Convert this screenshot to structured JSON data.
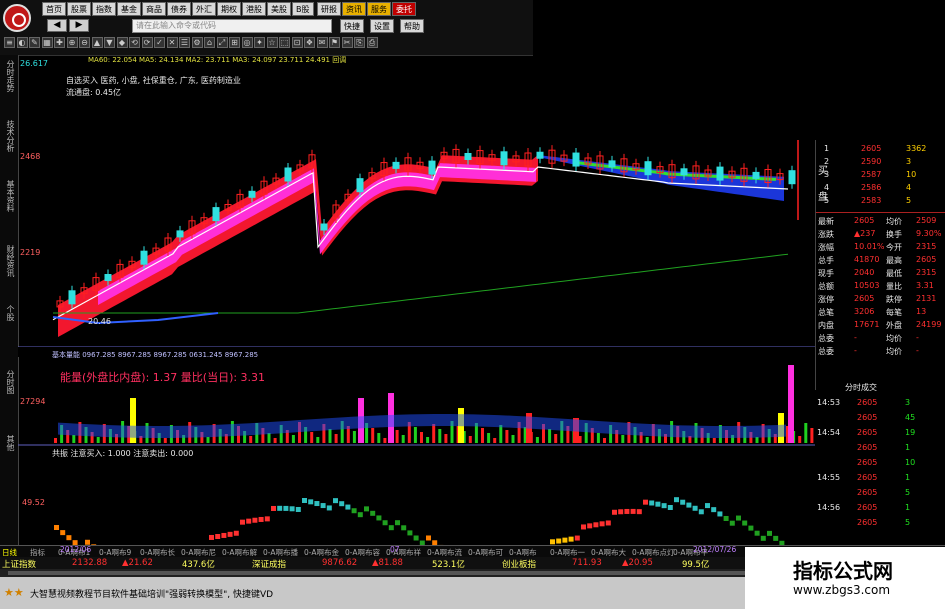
{
  "top_menu": [
    "首页",
    "股票",
    "指数",
    "基金",
    "商品",
    "债券",
    "外汇",
    "期权",
    "港股",
    "美股",
    "B股",
    "研报",
    "资讯",
    "服务",
    "委托"
  ],
  "top_menu_right": [
    "快捷",
    "设置",
    "帮助"
  ],
  "command_placeholder": "请在此输入命令或代码",
  "sidebar_tabs": [
    "分时走势",
    "技术分析",
    "基本资料",
    "财经资讯",
    "个股",
    "分时图",
    "其他"
  ],
  "chart": {
    "price_top": "26.617",
    "price_mid1": "2468",
    "price_mid2": "2219",
    "price_low": "20.46",
    "vol_top": "27294",
    "osc_mid": "49.52",
    "info_line": "MA60: 22.054  MA5: 24.134  MA2: 23.711  MA3: 24.097  23.711  24.491  回调",
    "note1": "自选买入 医药, 小盘, 社保重仓, 广东, 医药制造业",
    "note2": "流通盘: 0.45亿",
    "vol_label": "能量(外盘比内盘): 1.37   量比(当日): 3.31",
    "vol_indicator": "基本量能 0967.285  8967.285  8967.285  0631.245  8967.285",
    "osc_label": "共振   注意买入: 1.000   注意卖出: 0.000",
    "date_left": "2012/06",
    "date_mid": "07",
    "date_right": "2012/07/26"
  },
  "quote": {
    "bids": [
      {
        "label": "1",
        "price": "2605",
        "vol": "3362"
      },
      {
        "label": "2",
        "price": "2590",
        "vol": "3"
      },
      {
        "label": "3",
        "price": "2587",
        "vol": "10"
      },
      {
        "label": "4",
        "price": "2586",
        "vol": "4"
      },
      {
        "label": "5",
        "price": "2583",
        "vol": "5"
      }
    ],
    "side_labels": [
      "买",
      "盘"
    ],
    "fields": [
      [
        "最新",
        "2605",
        "均价",
        "2509"
      ],
      [
        "涨跌",
        "▲237",
        "换手",
        "9.30%"
      ],
      [
        "涨幅",
        "10.01%",
        "今开",
        "2315"
      ],
      [
        "总手",
        "41870",
        "最高",
        "2605"
      ],
      [
        "现手",
        "2040",
        "最低",
        "2315"
      ],
      [
        "总额",
        "10503",
        "量比",
        "3.31"
      ],
      [
        "涨停",
        "2605",
        "跌停",
        "2131"
      ],
      [
        "总笔",
        "3206",
        "每笔",
        "13"
      ],
      [
        "内盘",
        "17671",
        "外盘",
        "24199"
      ],
      [
        "总委",
        "-",
        "均价",
        "-"
      ],
      [
        "总委",
        "-",
        "均价",
        "-"
      ]
    ],
    "ticks_header": "分时成交",
    "ticks": [
      [
        "14:53",
        "2605",
        "3"
      ],
      [
        "",
        "2605",
        "45"
      ],
      [
        "14:54",
        "2605",
        "19"
      ],
      [
        "",
        "2605",
        "1"
      ],
      [
        "",
        "2605",
        "10"
      ],
      [
        "14:55",
        "2605",
        "1"
      ],
      [
        "",
        "2605",
        "5"
      ],
      [
        "14:56",
        "2605",
        "1"
      ],
      [
        "",
        "2605",
        "5"
      ]
    ]
  },
  "bottom_tabs": [
    "日线",
    "指标",
    "0-A啊布1",
    "0-A啊布9",
    "0-A啊布长",
    "0-A啊布尼",
    "0-A啊布解",
    "0-A啊布播",
    "0-A啊布金",
    "0-A啊布容",
    "0-A啊布祥",
    "0-A啊布流",
    "0-A啊布可",
    "0-A啊布",
    "0-A啊布一",
    "0-A啊布大",
    "0-A啊布点灯",
    "0-A啊布平"
  ],
  "ticker": [
    {
      "name": "上证指数",
      "value": "2132.88",
      "chg": "▲21.62",
      "amt": "437.6亿"
    },
    {
      "name": "深证成指",
      "value": "9876.62",
      "chg": "▲81.88",
      "amt": "523.1亿"
    },
    {
      "name": "创业板指",
      "value": "711.93",
      "chg": "▲20.95",
      "amt": "99.5亿"
    }
  ],
  "status_text": "大智慧视频教程节目软件基础培训\"强弱转换模型\", 快捷键VD",
  "watermark_title": "指标公式网",
  "watermark_url": "www.zbgs3.com",
  "colors": {
    "up": "#ff3030",
    "down": "#20e0e0",
    "magenta": "#ff20d0",
    "ma_white": "#ffffff"
  }
}
